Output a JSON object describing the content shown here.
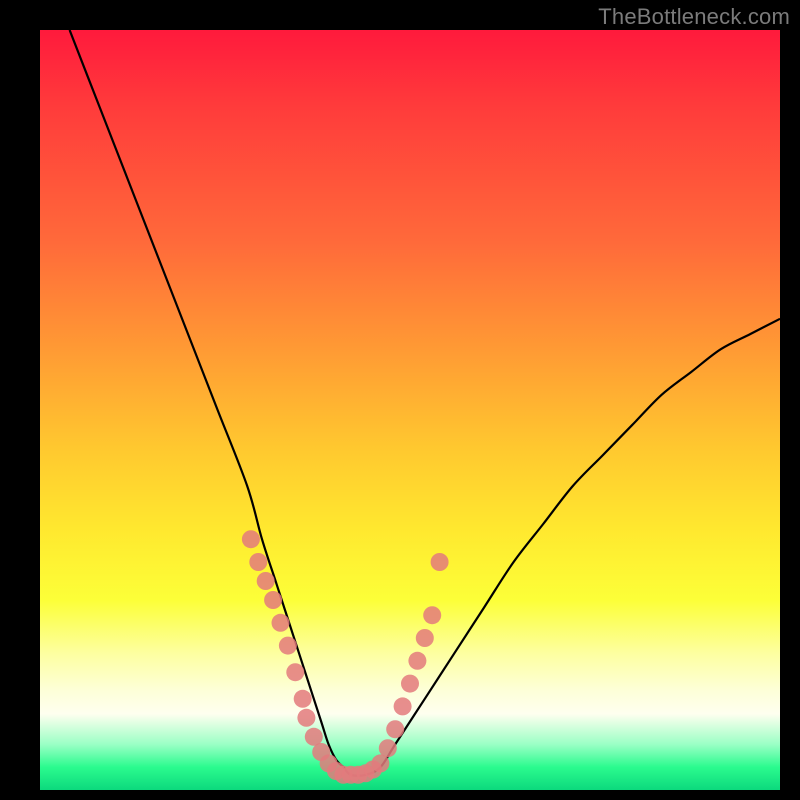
{
  "watermark": "TheBottleneck.com",
  "colors": {
    "frame": "#000000",
    "curve": "#000000",
    "dot": "#e37a7d",
    "gradient_top": "#ff1a3c",
    "gradient_bottom": "#0cd97d"
  },
  "chart_data": {
    "type": "line",
    "title": "",
    "xlabel": "",
    "ylabel": "",
    "xlim": [
      0,
      100
    ],
    "ylim": [
      0,
      100
    ],
    "series": [
      {
        "name": "bottleneck-curve",
        "x": [
          4,
          8,
          12,
          16,
          20,
          24,
          28,
          30,
          32,
          34,
          36,
          38,
          39,
          40,
          41,
          42,
          44,
          46,
          48,
          52,
          56,
          60,
          64,
          68,
          72,
          76,
          80,
          84,
          88,
          92,
          96,
          100
        ],
        "y": [
          100,
          90,
          80,
          70,
          60,
          50,
          40,
          33,
          27,
          21,
          15,
          9,
          6,
          4,
          3,
          2,
          2,
          3,
          6,
          12,
          18,
          24,
          30,
          35,
          40,
          44,
          48,
          52,
          55,
          58,
          60,
          62
        ]
      }
    ],
    "markers": {
      "name": "highlighted-points",
      "x": [
        28.5,
        29.5,
        30.5,
        31.5,
        32.5,
        33.5,
        34.5,
        35.5,
        36.0,
        37.0,
        38.0,
        39.0,
        40.0,
        41.0,
        42.0,
        43.0,
        44.0,
        45.0,
        46.0,
        47.0,
        48.0,
        49.0,
        50.0,
        51.0,
        52.0,
        53.0,
        54.0
      ],
      "y": [
        33.0,
        30.0,
        27.5,
        25.0,
        22.0,
        19.0,
        15.5,
        12.0,
        9.5,
        7.0,
        5.0,
        3.5,
        2.5,
        2.0,
        2.0,
        2.0,
        2.2,
        2.7,
        3.5,
        5.5,
        8.0,
        11.0,
        14.0,
        17.0,
        20.0,
        23.0,
        30.0
      ]
    }
  }
}
